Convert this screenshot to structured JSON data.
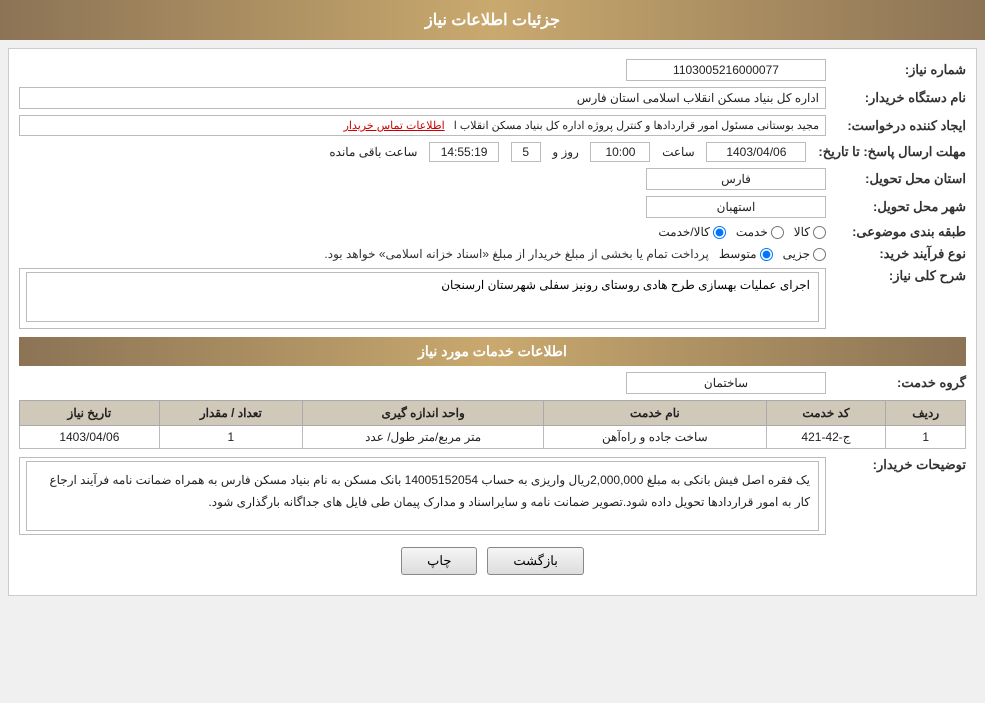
{
  "header": {
    "title": "جزئیات اطلاعات نیاز"
  },
  "fields": {
    "order_number_label": "شماره نیاز:",
    "order_number_value": "1103005216000077",
    "buyer_org_label": "نام دستگاه خریدار:",
    "buyer_org_value": "اداره کل بنیاد مسکن انقلاب اسلامی استان فارس",
    "requester_label": "ایجاد کننده درخواست:",
    "requester_value": "مجید بوستانی مسئول امور قراردادها و کنترل پروژه اداره کل بنیاد مسکن انقلاب ا",
    "contact_link_text": "اطلاعات تماس خریدار",
    "deadline_label": "مهلت ارسال پاسخ: تا تاریخ:",
    "deadline_date": "1403/04/06",
    "deadline_time_label": "ساعت",
    "deadline_time": "10:00",
    "deadline_days_label": "روز و",
    "deadline_days": "5",
    "deadline_remaining_label": "ساعت باقی مانده",
    "deadline_remaining": "14:55:19",
    "province_label": "استان محل تحویل:",
    "province_value": "فارس",
    "city_label": "شهر محل تحویل:",
    "city_value": "استهبان",
    "category_label": "طبقه بندی موضوعی:",
    "category_option1": "کالا",
    "category_option2": "خدمت",
    "category_option3": "کالا/خدمت",
    "purchase_type_label": "نوع فرآیند خرید:",
    "purchase_option1": "جزیی",
    "purchase_option2": "متوسط",
    "purchase_note": "پرداخت تمام یا بخشی از مبلغ خریدار از مبلغ «اسناد خزانه اسلامی» خواهد بود.",
    "description_label": "شرح کلی نیاز:",
    "description_value": "اجرای عملیات بهسازی طرح هادی روستای رونیز سفلی شهرستان ارسنجان",
    "services_header": "اطلاعات خدمات مورد نیاز",
    "service_group_label": "گروه خدمت:",
    "service_group_value": "ساختمان",
    "table_headers": {
      "row_num": "ردیف",
      "service_code": "کد خدمت",
      "service_name": "نام خدمت",
      "unit": "واحد اندازه گیری",
      "quantity": "تعداد / مقدار",
      "date": "تاریخ نیاز"
    },
    "table_rows": [
      {
        "row_num": "1",
        "service_code": "ج-42-421",
        "service_name": "ساخت جاده و راه‌آهن",
        "unit": "متر مربع/متر طول/ عدد",
        "quantity": "1",
        "date": "1403/04/06"
      }
    ],
    "buyer_desc_label": "توضیحات خریدار:",
    "buyer_desc_value": "یک فقره اصل فیش بانکی به مبلغ 2,000,000ریال واریزی به حساب 14005152054 بانک مسکن به نام بنیاد مسکن فارس به همراه ضمانت نامه فرآیند ارجاع کار به امور قراردادها تحویل داده شود.تصویر ضمانت نامه و سایراسناد و مدارک پیمان طی فایل های جداگانه بارگذاری شود.",
    "btn_print": "چاپ",
    "btn_back": "بازگشت"
  }
}
